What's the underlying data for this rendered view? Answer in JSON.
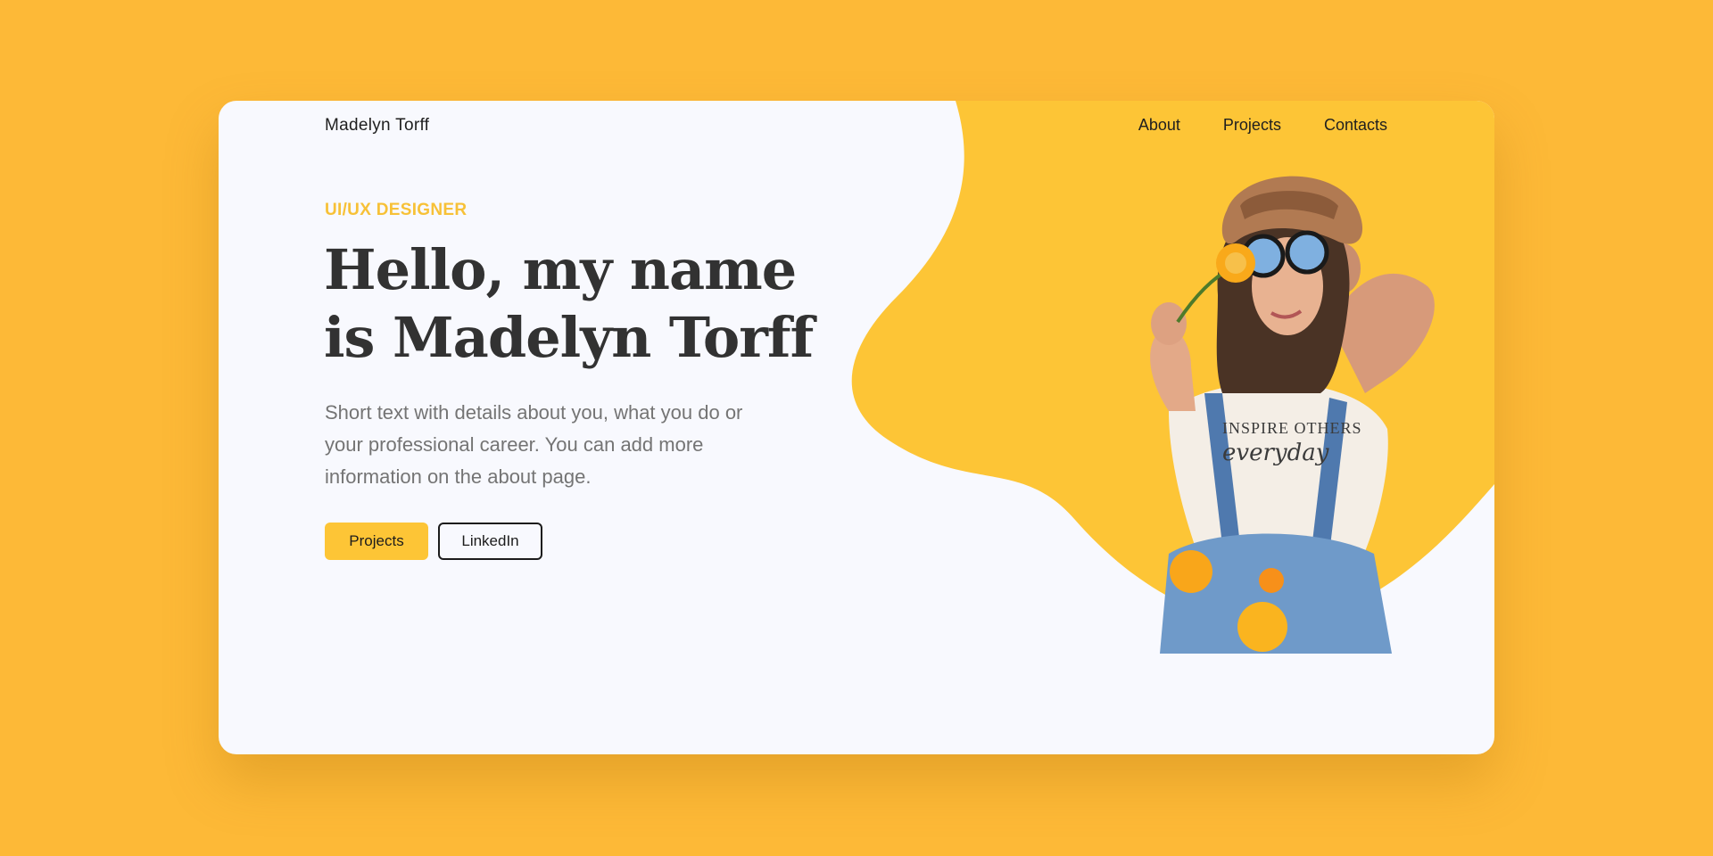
{
  "colors": {
    "page_background": "#FDB937",
    "card_background": "#F8F9FE",
    "accent": "#FDC536",
    "eyebrow": "#F7C137",
    "headline": "#323232",
    "body_text": "#747474"
  },
  "nav": {
    "brand": "Madelyn Torff",
    "links": [
      "About",
      "Projects",
      "Contacts"
    ]
  },
  "hero": {
    "eyebrow": "UI/UX DESIGNER",
    "headline": "Hello,  my name is Madelyn Torff",
    "intro": "Short text with details about you, what you do or your professional career. You can add more information on the about page.",
    "buttons": {
      "primary": "Projects",
      "secondary": "LinkedIn"
    }
  },
  "image": {
    "shirt_text_top": "INSPIRE OTHERS",
    "shirt_text_script": "everyday"
  }
}
